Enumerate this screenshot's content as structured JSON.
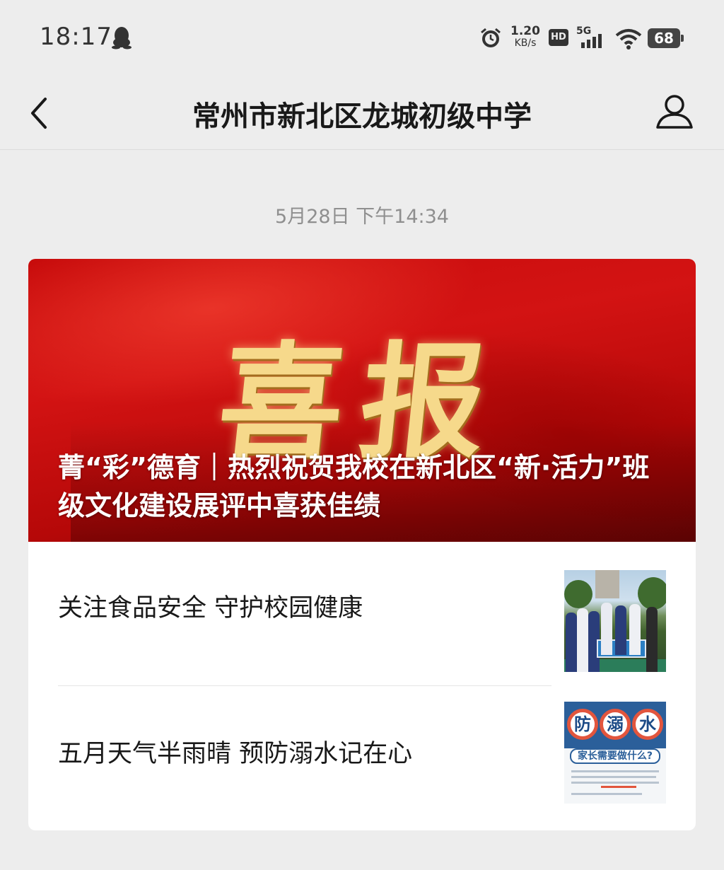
{
  "status_bar": {
    "time": "18:17",
    "net_speed_value": "1.20",
    "net_speed_unit": "KB/s",
    "hd_label": "HD",
    "network_label": "5G",
    "battery_level": "68",
    "icons": [
      "qq-penguin-icon",
      "alarm-icon",
      "signal-icon",
      "wifi-icon",
      "battery-icon"
    ]
  },
  "nav": {
    "title": "常州市新北区龙城初级中学",
    "back_icon": "chevron-left-icon",
    "profile_icon": "person-icon"
  },
  "message": {
    "timestamp": "5月28日 下午14:34",
    "cover": {
      "art_text": "喜报",
      "title": "菁“彩”德育｜热烈祝贺我校在新北区“新·活力”班级文化建设展评中喜获佳绩"
    },
    "articles": [
      {
        "title": "关注食品安全 守护校园健康",
        "thumb": "students-schoolyard-photo"
      },
      {
        "title": "五月天气半雨晴 预防溺水记在心",
        "thumb": "drowning-prevention-poster"
      }
    ],
    "poster": {
      "ring_1": "防",
      "ring_2": "溺",
      "ring_3": "水",
      "subtitle": "家长需要做什么?"
    }
  },
  "colors": {
    "background": "#ededed",
    "card": "#ffffff",
    "banner_red": "#c80c0c",
    "banner_gold": "#f6d98b",
    "timestamp_gray": "#8f8f8f"
  }
}
